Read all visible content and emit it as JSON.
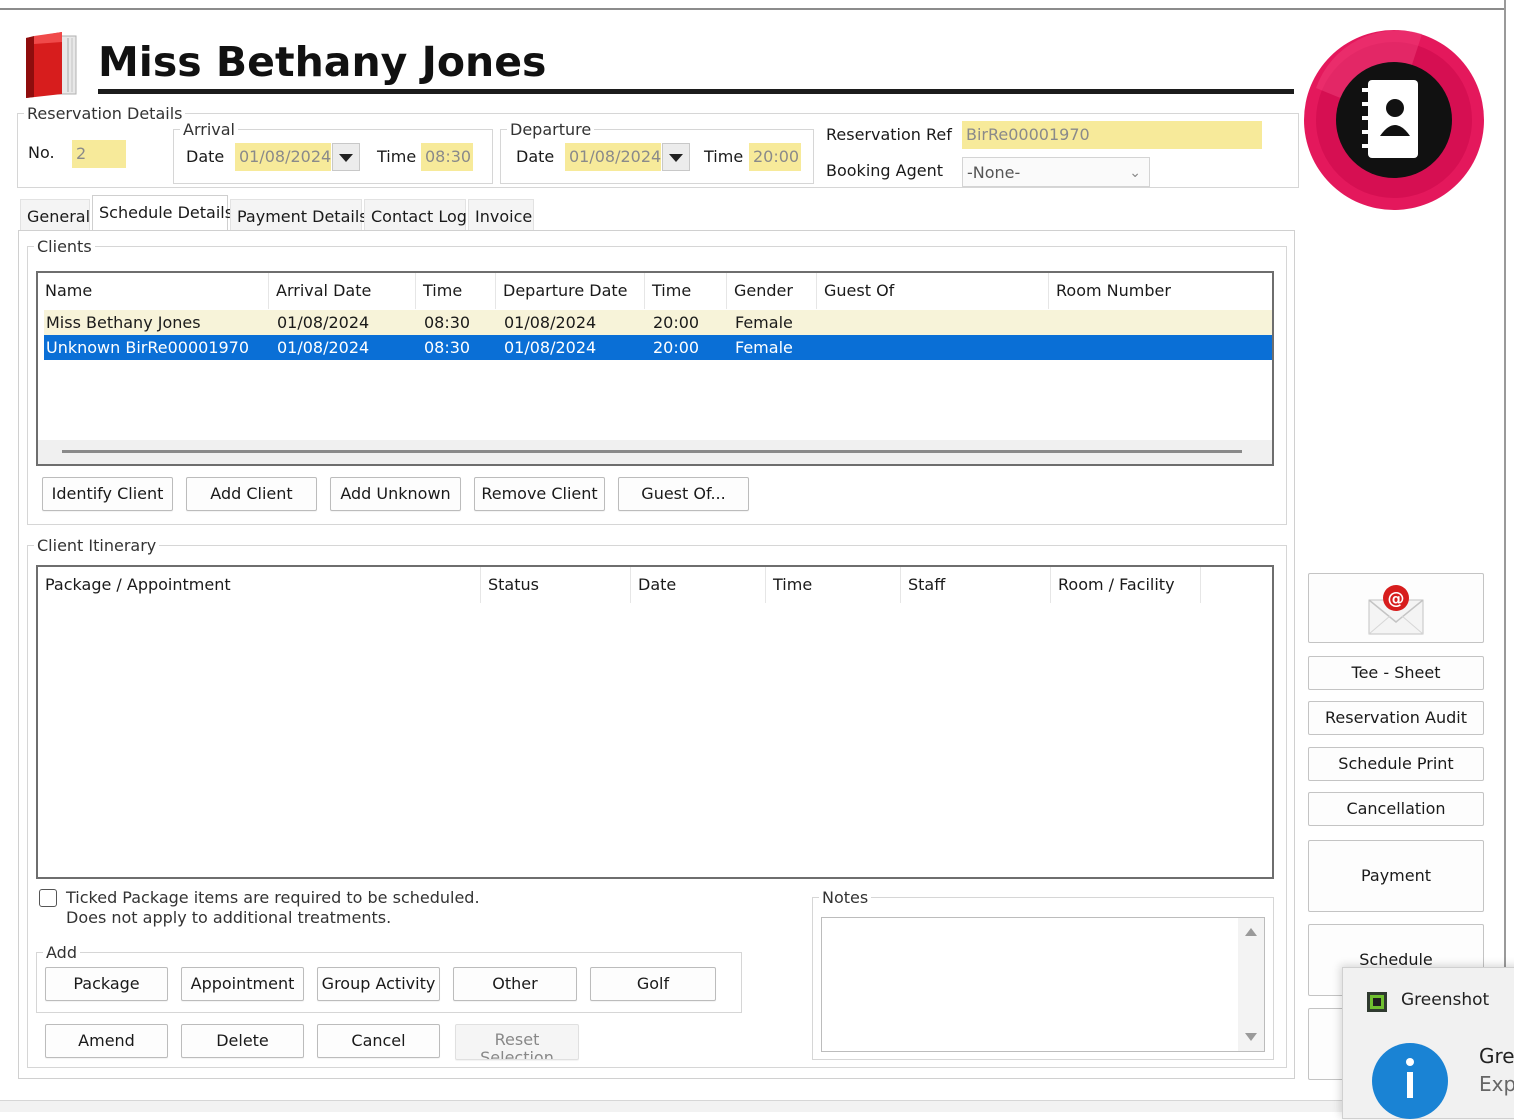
{
  "window": {
    "title": "Miss Bethany Jones"
  },
  "reservation": {
    "legend": "Reservation Details",
    "no_label": "No.",
    "no_value": "2",
    "arrival_legend": "Arrival",
    "departure_legend": "Departure",
    "date_label": "Date",
    "time_label": "Time",
    "arrival_date": "01/08/2024",
    "arrival_time": "08:30",
    "departure_date": "01/08/2024",
    "departure_time": "20:00",
    "ref_label": "Reservation Ref",
    "ref_value": "BirRe00001970",
    "agent_label": "Booking Agent",
    "agent_value": "-None-"
  },
  "tabs": [
    {
      "label": "General",
      "active": false
    },
    {
      "label": "Schedule Details",
      "active": true
    },
    {
      "label": "Payment Details",
      "active": false
    },
    {
      "label": "Contact Log",
      "active": false
    },
    {
      "label": "Invoice",
      "active": false
    }
  ],
  "clients": {
    "legend": "Clients",
    "columns": [
      "Name",
      "Arrival Date",
      "Time",
      "Departure Date",
      "Time",
      "Gender",
      "Guest Of",
      "Room Number"
    ],
    "rows": [
      {
        "name": "Miss Bethany Jones",
        "arrival_date": "01/08/2024",
        "arrival_time": "08:30",
        "departure_date": "01/08/2024",
        "departure_time": "20:00",
        "gender": "Female",
        "guest_of": "",
        "room": ""
      },
      {
        "name": "Unknown BirRe00001970",
        "arrival_date": "01/08/2024",
        "arrival_time": "08:30",
        "departure_date": "01/08/2024",
        "departure_time": "20:00",
        "gender": "Female",
        "guest_of": "",
        "room": ""
      }
    ],
    "buttons": [
      "Identify Client",
      "Add Client",
      "Add Unknown",
      "Remove Client",
      "Guest Of..."
    ]
  },
  "itinerary": {
    "legend": "Client Itinerary",
    "columns": [
      "Package / Appointment",
      "Status",
      "Date",
      "Time",
      "Staff",
      "Room / Facility"
    ],
    "checkbox_line1": "Ticked Package items are required to be scheduled.",
    "checkbox_line2": "Does not apply to additional treatments.",
    "add_legend": "Add",
    "add_buttons": [
      "Package",
      "Appointment",
      "Group Activity",
      "Other",
      "Golf"
    ],
    "action_buttons": [
      "Amend",
      "Delete",
      "Cancel"
    ],
    "reset_line1": "Reset",
    "reset_line2": "Selection"
  },
  "notes": {
    "legend": "Notes",
    "value": ""
  },
  "side_buttons": {
    "tee_sheet": "Tee - Sheet",
    "audit": "Reservation Audit",
    "schedule_print": "Schedule Print",
    "cancellation": "Cancellation",
    "payment": "Payment",
    "schedule": "Schedule"
  },
  "toast": {
    "app": "Greenshot",
    "line1": "Gre",
    "line2": "Exp"
  },
  "colors": {
    "field_yellow": "#f7ea9a",
    "row_highlight": "#f7f3d9",
    "selection_blue": "#0a6fd6",
    "badge_pink": "#e4185c"
  }
}
